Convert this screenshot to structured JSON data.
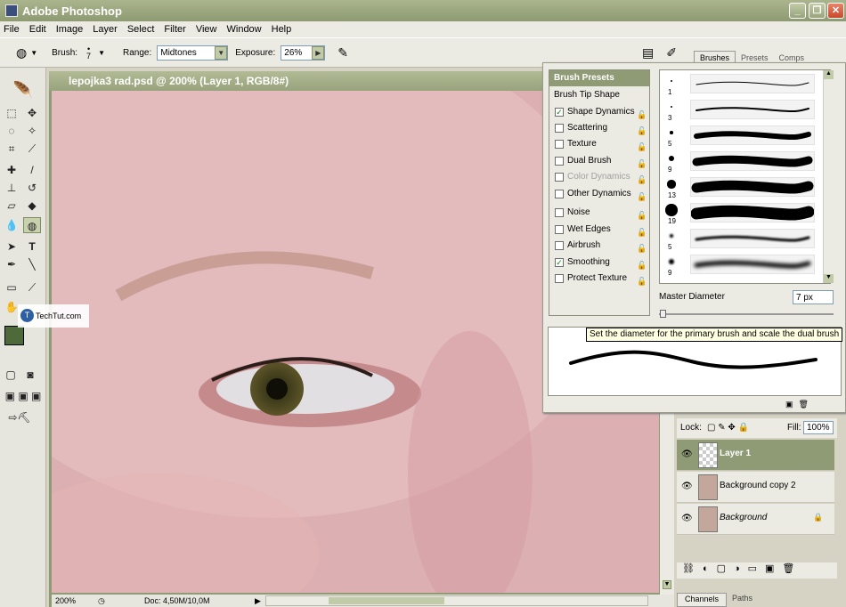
{
  "app": {
    "title": "Adobe Photoshop"
  },
  "menu": [
    "File",
    "Edit",
    "Image",
    "Layer",
    "Select",
    "Filter",
    "View",
    "Window",
    "Help"
  ],
  "options": {
    "brush_label": "Brush:",
    "brush_size": "7",
    "range_label": "Range:",
    "range_value": "Midtones",
    "exposure_label": "Exposure:",
    "exposure_value": "26%"
  },
  "document": {
    "title": "lepojka3 rad.psd @ 200% (Layer 1, RGB/8#)",
    "zoom": "200%",
    "doc_info": "Doc: 4,50M/10,0M"
  },
  "watermark": "TechTut.com",
  "panel_tabs": {
    "brushes": "Brushes",
    "presets": "Presets",
    "comps": "Comps"
  },
  "brush_panel": {
    "header": "Brush Presets",
    "tip_shape": "Brush Tip Shape",
    "options": [
      {
        "label": "Shape Dynamics",
        "checked": true,
        "enabled": true
      },
      {
        "label": "Scattering",
        "checked": false,
        "enabled": true
      },
      {
        "label": "Texture",
        "checked": false,
        "enabled": true
      },
      {
        "label": "Dual Brush",
        "checked": false,
        "enabled": true
      },
      {
        "label": "Color Dynamics",
        "checked": false,
        "enabled": false
      },
      {
        "label": "Other Dynamics",
        "checked": false,
        "enabled": true
      },
      {
        "label": "Noise",
        "checked": false,
        "enabled": true
      },
      {
        "label": "Wet Edges",
        "checked": false,
        "enabled": true
      },
      {
        "label": "Airbrush",
        "checked": false,
        "enabled": true
      },
      {
        "label": "Smoothing",
        "checked": true,
        "enabled": true
      },
      {
        "label": "Protect Texture",
        "checked": false,
        "enabled": true
      }
    ],
    "presets": [
      "1",
      "3",
      "5",
      "9",
      "13",
      "19",
      "5",
      "9"
    ],
    "master_diameter_label": "Master Diameter",
    "master_diameter_value": "7 px",
    "tooltip": "Set the diameter for the primary brush and scale the dual brush"
  },
  "layers": {
    "lock_label": "Lock:",
    "fill_label": "Fill:",
    "fill_value": "100%",
    "items": [
      {
        "name": "Layer 1",
        "selected": true
      },
      {
        "name": "Background copy 2",
        "selected": false
      },
      {
        "name": "Background",
        "selected": false,
        "locked": true
      }
    ]
  },
  "bottom_tabs": {
    "channels": "Channels",
    "paths": "Paths"
  }
}
